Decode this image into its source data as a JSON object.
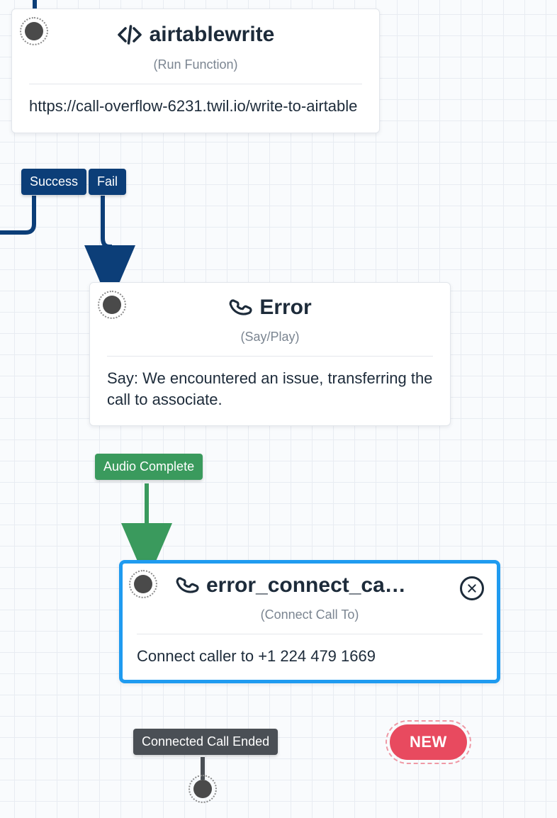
{
  "colors": {
    "navy": "#0c3e78",
    "green": "#3a9a5d",
    "gray": "#4a4f55",
    "red": "#e84a5f",
    "select": "#1f9bf0"
  },
  "nodes": {
    "airtablewrite": {
      "title": "airtablewrite",
      "type_label": "(Run Function)",
      "body": "https://call-overflow-6231.twil.io/write-to-airtable",
      "transitions": {
        "success": "Success",
        "fail": "Fail"
      }
    },
    "error": {
      "title": "Error",
      "type_label": "(Say/Play)",
      "body": "Say: We encountered an issue, transferring the call to associate.",
      "transitions": {
        "audio_complete": "Audio Complete"
      }
    },
    "error_connect": {
      "title": "error_connect_ca…",
      "type_label": "(Connect Call To)",
      "body": "Connect caller to +1 224 479 1669",
      "transitions": {
        "connected_call_ended": "Connected Call Ended"
      },
      "new_label": "NEW"
    }
  }
}
